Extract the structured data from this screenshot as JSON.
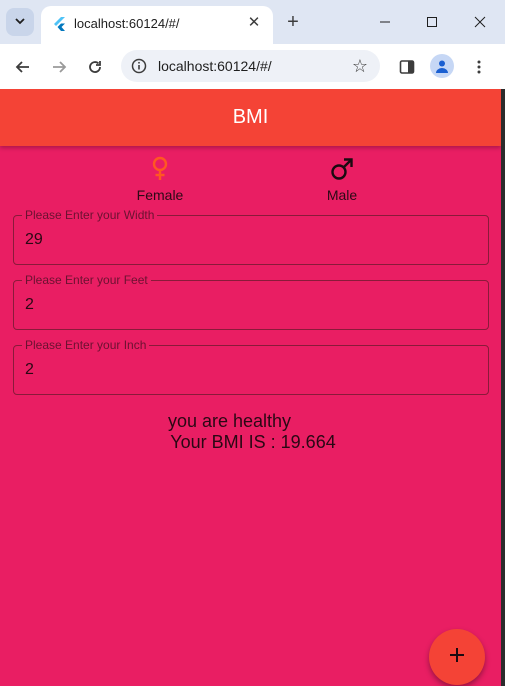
{
  "browser": {
    "tab_title": "localhost:60124/#/",
    "address": "localhost:60124/#/",
    "icons": {
      "tab_search": "chevron-down-icon",
      "favicon": "flutter-icon",
      "close": "close-icon",
      "new_tab": "plus-icon",
      "minimize": "minimize-icon",
      "maximize": "maximize-icon",
      "close_window": "close-window-icon",
      "back": "back-arrow-icon",
      "forward": "forward-arrow-icon",
      "reload": "reload-icon",
      "site_info": "info-icon",
      "bookmark": "star-icon",
      "side_panel": "side-panel-icon",
      "profile": "profile-icon",
      "menu": "more-vert-icon"
    }
  },
  "app": {
    "title": "BMI",
    "colors": {
      "app_bar": "#f44336",
      "background": "#e91e63",
      "female_icon": "#ff5722",
      "fab": "#f44336"
    },
    "gender": {
      "female_label": "Female",
      "male_label": "Male"
    },
    "fields": [
      {
        "label": "Please Enter your Width",
        "value": "29"
      },
      {
        "label": "Please Enter your Feet",
        "value": "2"
      },
      {
        "label": "Please Enter your Inch",
        "value": "2"
      }
    ],
    "result": {
      "status": "you are healthy",
      "bmi": "Your BMI IS : 19.664"
    },
    "fab_icon": "plus-icon"
  }
}
